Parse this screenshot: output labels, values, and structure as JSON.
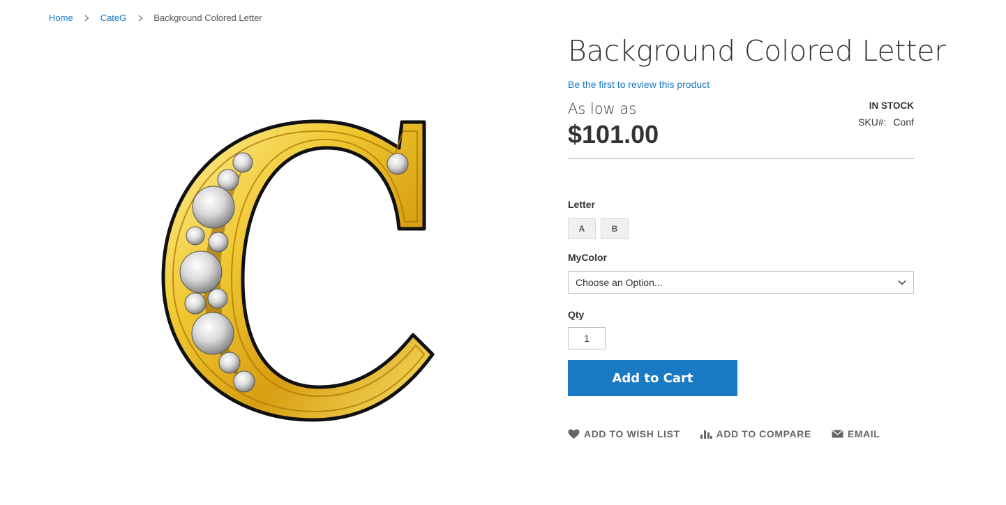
{
  "breadcrumb": {
    "home": "Home",
    "category": "CateG",
    "current": "Background Colored Letter"
  },
  "product": {
    "title": "Background Colored Letter",
    "review_link": "Be the first to review this product",
    "price_prefix": "As low as",
    "price": "$101.00",
    "stock": "IN STOCK",
    "sku_label": "SKU#:",
    "sku_value": "Conf",
    "image_icon": "gold-letter-c-with-diamonds-icon"
  },
  "options": {
    "letter_label": "Letter",
    "letter_swatches": [
      "A",
      "B"
    ],
    "color_label": "MyColor",
    "color_select_value": "Choose an Option...",
    "qty_label": "Qty",
    "qty_value": "1"
  },
  "actions": {
    "add_to_cart": "Add to Cart",
    "wish_list": "Add to Wish List",
    "compare": "Add to Compare",
    "email": "Email"
  },
  "colors": {
    "link": "#1979c3",
    "button": "#1979c3",
    "text": "#333333",
    "gold": "#e8c23a"
  }
}
